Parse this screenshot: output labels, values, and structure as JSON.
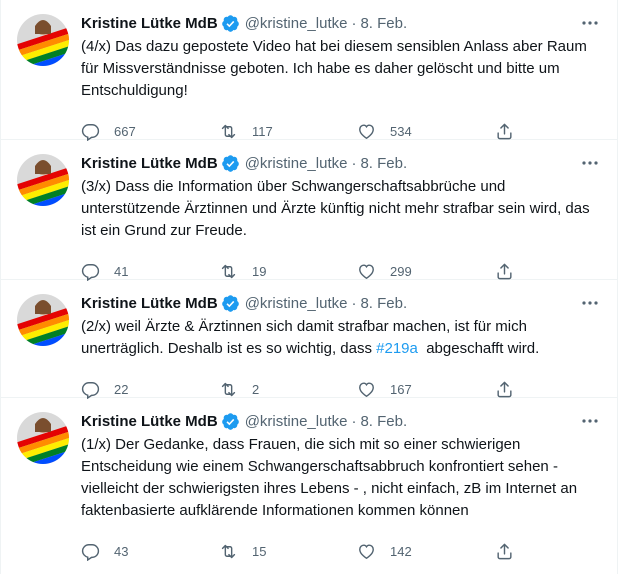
{
  "colors": {
    "text": "#0f1419",
    "secondary": "#536471",
    "link": "#1d9bf0",
    "verified": "#1d9bf0",
    "divider": "#eff3f4"
  },
  "tweets": [
    {
      "author": "Kristine Lütke MdB",
      "handle": "@kristine_lutke",
      "sep": "·",
      "date": "8. Feb.",
      "text_before": "(4/x) Das dazu gepostete Video hat bei diesem sensiblen Anlass aber Raum für Missverständnisse geboten. Ich habe es daher gelöscht und bitte um Entschuldigung!",
      "hashtag": "",
      "text_after": "",
      "replies": "667",
      "retweets": "117",
      "likes": "534",
      "icons": [
        "reply-icon",
        "retweet-icon",
        "like-icon",
        "share-icon"
      ]
    },
    {
      "author": "Kristine Lütke MdB",
      "handle": "@kristine_lutke",
      "sep": "·",
      "date": "8. Feb.",
      "text_before": "(3/x) Dass die Information über Schwangerschaftsabbrüche und unterstützende Ärztinnen und Ärzte künftig nicht mehr strafbar sein wird, das ist ein Grund zur Freude.",
      "hashtag": "",
      "text_after": "",
      "replies": "41",
      "retweets": "19",
      "likes": "299",
      "icons": [
        "reply-icon",
        "retweet-icon",
        "like-icon",
        "share-icon"
      ]
    },
    {
      "author": "Kristine Lütke MdB",
      "handle": "@kristine_lutke",
      "sep": "·",
      "date": "8. Feb.",
      "text_before": "(2/x) weil Ärzte & Ärztinnen sich damit strafbar machen, ist für mich unerträglich. Deshalb ist es so wichtig, dass ",
      "hashtag": "#219a",
      "text_after": "  abgeschafft wird.",
      "replies": "22",
      "retweets": "2",
      "likes": "167",
      "icons": [
        "reply-icon",
        "retweet-icon",
        "like-icon",
        "share-icon"
      ]
    },
    {
      "author": "Kristine Lütke MdB",
      "handle": "@kristine_lutke",
      "sep": "·",
      "date": "8. Feb.",
      "text_before": "(1/x) Der Gedanke, dass Frauen, die sich mit so einer schwierigen Entscheidung wie einem Schwangerschaftsabbruch konfrontiert sehen - vielleicht der schwierigsten ihres Lebens - , nicht einfach, zB im Internet an faktenbasierte aufklärende Informationen kommen können",
      "hashtag": "",
      "text_after": "",
      "replies": "43",
      "retweets": "15",
      "likes": "142",
      "icons": [
        "reply-icon",
        "retweet-icon",
        "like-icon",
        "share-icon"
      ]
    }
  ]
}
